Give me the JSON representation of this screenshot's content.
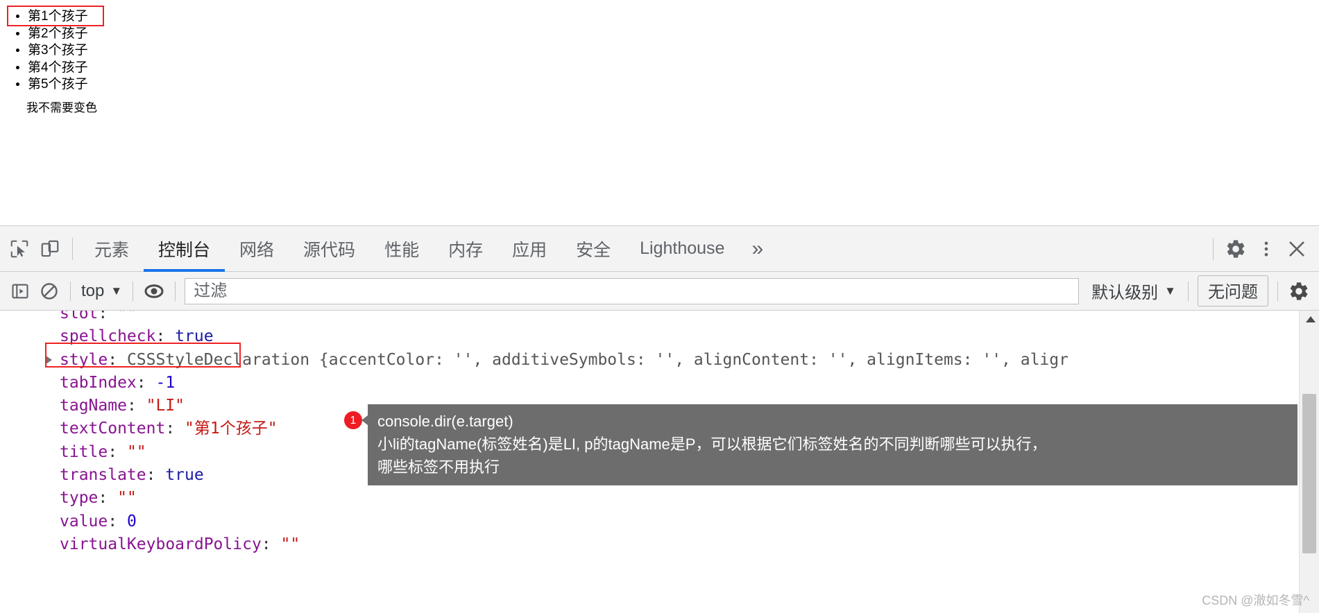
{
  "page": {
    "list_items": [
      "第1个孩子",
      "第2个孩子",
      "第3个孩子",
      "第4个孩子",
      "第5个孩子"
    ],
    "paragraph": "我不需要变色",
    "highlight_color": "#ee2222"
  },
  "devtools": {
    "toolbar_icons": {
      "inspect": "inspect-cursor-icon",
      "device": "device-toolbar-icon"
    },
    "tabs": [
      {
        "label": "元素",
        "active": false
      },
      {
        "label": "控制台",
        "active": true
      },
      {
        "label": "网络",
        "active": false
      },
      {
        "label": "源代码",
        "active": false
      },
      {
        "label": "性能",
        "active": false
      },
      {
        "label": "内存",
        "active": false
      },
      {
        "label": "应用",
        "active": false
      },
      {
        "label": "安全",
        "active": false
      },
      {
        "label": "Lighthouse",
        "active": false
      }
    ],
    "more_tabs_label": "»",
    "right_icons": {
      "settings": "gear-icon",
      "menu": "kebab-menu-icon",
      "close": "close-icon"
    },
    "active_tab_color": "#1a73e8",
    "filterbar": {
      "sidebar_toggle": "console-sidebar-icon",
      "clear": "clear-console-icon",
      "context": "top",
      "context_caret": "▼",
      "eye": "live-expression-icon",
      "filter_value": "",
      "filter_placeholder": "过滤",
      "level": "默认级别",
      "level_caret": "▼",
      "issues": "无问题",
      "settings": "gear-icon"
    },
    "console_lines": [
      {
        "indent": 1,
        "expandable": false,
        "key": "slot",
        "value": "\"\"",
        "vtype": "str"
      },
      {
        "indent": 1,
        "expandable": false,
        "key": "spellcheck",
        "value": "true",
        "vtype": "bool"
      },
      {
        "indent": 1,
        "expandable": true,
        "key": "style",
        "value": "CSSStyleDeclaration {accentColor: '', additiveSymbols: '', alignContent: '', alignItems: '', aligr",
        "vtype": "obj"
      },
      {
        "indent": 1,
        "expandable": false,
        "key": "tabIndex",
        "value": "-1",
        "vtype": "num"
      },
      {
        "indent": 1,
        "expandable": false,
        "key": "tagName",
        "value": "\"LI\"",
        "vtype": "str",
        "highlighted": true
      },
      {
        "indent": 1,
        "expandable": false,
        "key": "textContent",
        "value": "\"第1个孩子\"",
        "vtype": "str"
      },
      {
        "indent": 1,
        "expandable": false,
        "key": "title",
        "value": "\"\"",
        "vtype": "str"
      },
      {
        "indent": 1,
        "expandable": false,
        "key": "translate",
        "value": "true",
        "vtype": "bool"
      },
      {
        "indent": 1,
        "expandable": false,
        "key": "type",
        "value": "\"\"",
        "vtype": "str"
      },
      {
        "indent": 1,
        "expandable": false,
        "key": "value",
        "value": "0",
        "vtype": "num"
      },
      {
        "indent": 1,
        "expandable": false,
        "key": "virtualKeyboardPolicy",
        "value": "\"\"",
        "vtype": "str"
      }
    ]
  },
  "annotation": {
    "badge": "1",
    "line1": "console.dir(e.target)",
    "line2": "小li的tagName(标签姓名)是LI, p的tagName是P，可以根据它们标签姓名的不同判断哪些可以执行，",
    "line3": "哪些标签不用执行",
    "background": "#6d6d6d",
    "badge_color": "#ee1c25"
  },
  "watermark": "CSDN @澈如冬雪^"
}
